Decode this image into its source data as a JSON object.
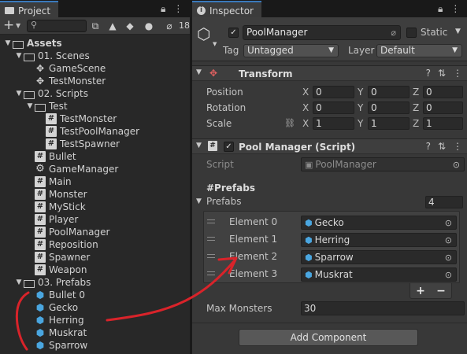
{
  "project_panel": {
    "tab_label": "Project",
    "hidden_count": "18",
    "tree": [
      {
        "label": "Assets",
        "icon": "folder-open",
        "depth": 0,
        "expanded": true,
        "bold": true
      },
      {
        "label": "01. Scenes",
        "icon": "folder-open",
        "depth": 1,
        "expanded": true
      },
      {
        "label": "GameScene",
        "icon": "unity",
        "depth": 2
      },
      {
        "label": "TestMonster",
        "icon": "unity",
        "depth": 2
      },
      {
        "label": "02. Scripts",
        "icon": "folder-open",
        "depth": 1,
        "expanded": true
      },
      {
        "label": "Test",
        "icon": "folder-open",
        "depth": 2,
        "expanded": true
      },
      {
        "label": "TestMonster",
        "icon": "script",
        "depth": 3
      },
      {
        "label": "TestPoolManager",
        "icon": "script",
        "depth": 3
      },
      {
        "label": "TestSpawner",
        "icon": "script",
        "depth": 3
      },
      {
        "label": "Bullet",
        "icon": "script",
        "depth": 2
      },
      {
        "label": "GameManager",
        "icon": "gear",
        "depth": 2
      },
      {
        "label": "Main",
        "icon": "script",
        "depth": 2
      },
      {
        "label": "Monster",
        "icon": "script",
        "depth": 2
      },
      {
        "label": "MyStick",
        "icon": "script",
        "depth": 2
      },
      {
        "label": "Player",
        "icon": "script",
        "depth": 2
      },
      {
        "label": "PoolManager",
        "icon": "script",
        "depth": 2
      },
      {
        "label": "Reposition",
        "icon": "script",
        "depth": 2
      },
      {
        "label": "Spawner",
        "icon": "script",
        "depth": 2
      },
      {
        "label": "Weapon",
        "icon": "script",
        "depth": 2
      },
      {
        "label": "03. Prefabs",
        "icon": "folder-open",
        "depth": 1,
        "expanded": true
      },
      {
        "label": "Bullet 0",
        "icon": "prefab",
        "depth": 2
      },
      {
        "label": "Gecko",
        "icon": "prefab",
        "depth": 2
      },
      {
        "label": "Herring",
        "icon": "prefab",
        "depth": 2
      },
      {
        "label": "Muskrat",
        "icon": "prefab",
        "depth": 2
      },
      {
        "label": "Sparrow",
        "icon": "prefab",
        "depth": 2
      }
    ]
  },
  "inspector": {
    "tab_label": "Inspector",
    "object_name": "PoolManager",
    "active": true,
    "static_label": "Static",
    "tag_label": "Tag",
    "tag_value": "Untagged",
    "layer_label": "Layer",
    "layer_value": "Default",
    "transform": {
      "title": "Transform",
      "rows": [
        {
          "label": "Position",
          "x": "0",
          "y": "0",
          "z": "0"
        },
        {
          "label": "Rotation",
          "x": "0",
          "y": "0",
          "z": "0"
        },
        {
          "label": "Scale",
          "x": "1",
          "y": "1",
          "z": "1"
        }
      ],
      "axis_x": "X",
      "axis_y": "Y",
      "axis_z": "Z"
    },
    "pool_manager": {
      "title": "Pool Manager (Script)",
      "script_label": "Script",
      "script_value": "PoolManager",
      "header": "#Prefabs",
      "prefabs_label": "Prefabs",
      "prefabs_count": "4",
      "elements": [
        {
          "label": "Element 0",
          "value": "Gecko"
        },
        {
          "label": "Element 1",
          "value": "Herring"
        },
        {
          "label": "Element 2",
          "value": "Sparrow"
        },
        {
          "label": "Element 3",
          "value": "Muskrat"
        }
      ],
      "plus": "+",
      "minus": "−",
      "max_monsters_label": "Max Monsters",
      "max_monsters_value": "30"
    },
    "add_component_label": "Add Component"
  },
  "colors": {
    "annotation_red": "#d9232a",
    "prefab_blue": "#4aa6e0",
    "tab_accent": "#3a79bb"
  }
}
